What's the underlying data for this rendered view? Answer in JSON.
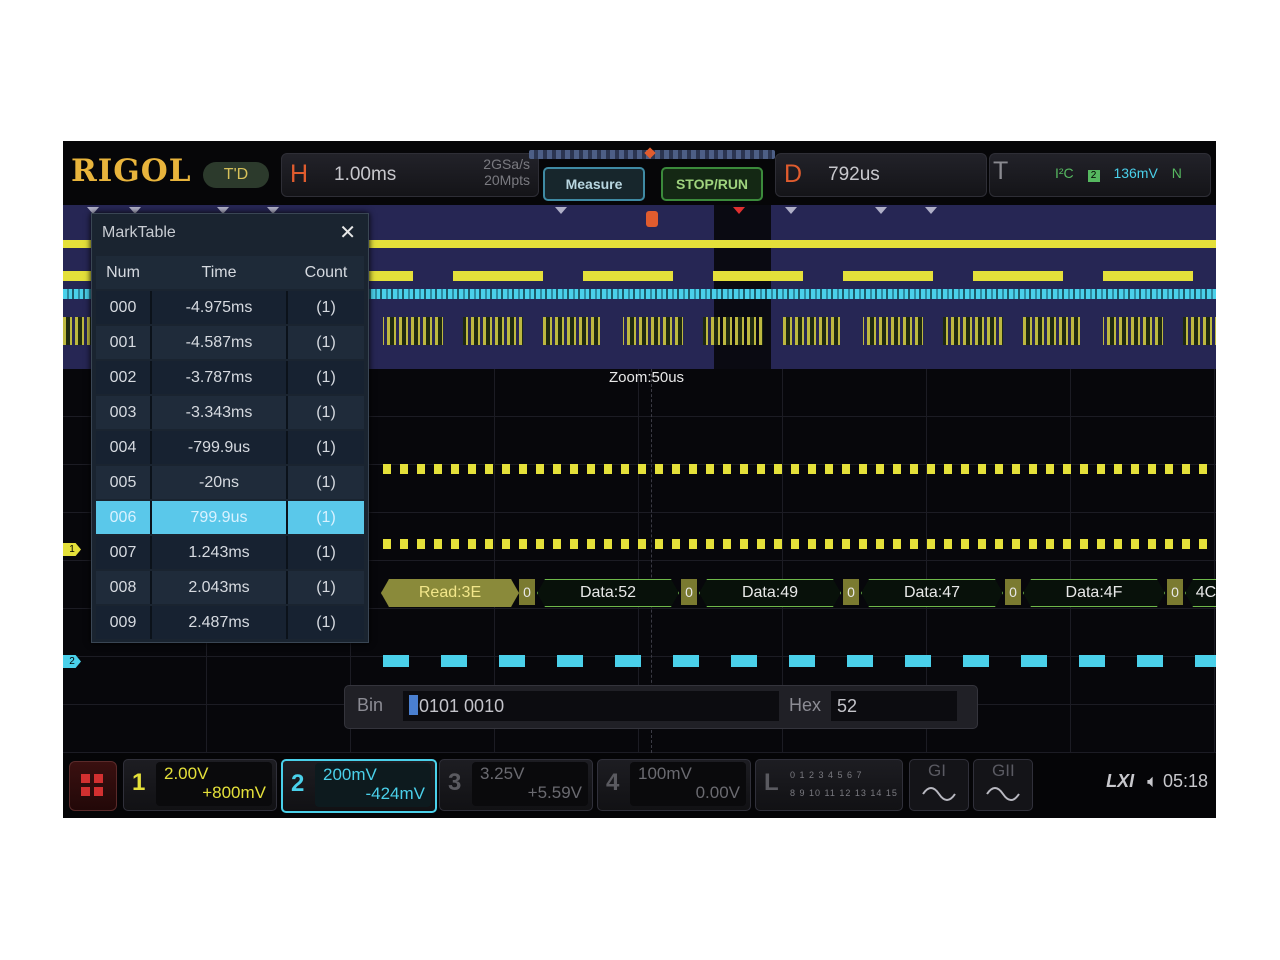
{
  "topbar": {
    "logo": "RIGOL",
    "mode_badge": "T'D",
    "horizontal": {
      "key": "H",
      "timebase": "1.00ms",
      "sample_rate": "2GSa/s",
      "memory_depth": "20Mpts"
    },
    "measure_label": "Measure",
    "stoprun_label": "STOP/RUN",
    "delay": {
      "key": "D",
      "value": "792us"
    },
    "trigger": {
      "key": "T",
      "type": "I²C",
      "channel": "2",
      "level": "136mV",
      "mode": "N"
    }
  },
  "zoom_label": "Zoom:50us",
  "marktable": {
    "title": "MarkTable",
    "close_icon": "close-icon",
    "columns": [
      "Num",
      "Time",
      "Count"
    ],
    "rows": [
      {
        "num": "000",
        "time": "-4.975ms",
        "count": "(1)"
      },
      {
        "num": "001",
        "time": "-4.587ms",
        "count": "(1)"
      },
      {
        "num": "002",
        "time": "-3.787ms",
        "count": "(1)"
      },
      {
        "num": "003",
        "time": "-3.343ms",
        "count": "(1)"
      },
      {
        "num": "004",
        "time": "-799.9us",
        "count": "(1)"
      },
      {
        "num": "005",
        "time": "-20ns",
        "count": "(1)"
      },
      {
        "num": "006",
        "time": "799.9us",
        "count": "(1)"
      },
      {
        "num": "007",
        "time": "1.243ms",
        "count": "(1)"
      },
      {
        "num": "008",
        "time": "2.043ms",
        "count": "(1)"
      },
      {
        "num": "009",
        "time": "2.487ms",
        "count": "(1)"
      }
    ],
    "selected_index": 6
  },
  "decode": {
    "packets": [
      "Read:3E",
      "Data:52",
      "Data:49",
      "Data:47",
      "Data:4F",
      "4C"
    ],
    "ack": "0"
  },
  "channel_markers": {
    "ch1": "1",
    "ch2": "2"
  },
  "binhex": {
    "bin_label": "Bin",
    "bin_value": "0101 0010",
    "hex_label": "Hex",
    "hex_value": "52"
  },
  "channels": [
    {
      "num": "1",
      "scale": "2.00V",
      "offset": "+800mV",
      "color": "#e4e03a"
    },
    {
      "num": "2",
      "scale": "200mV",
      "offset": "-424mV",
      "color": "#4ad0ea"
    },
    {
      "num": "3",
      "scale": "3.25V",
      "offset": "+5.59V",
      "color": "#6a6a70"
    },
    {
      "num": "4",
      "scale": "100mV",
      "offset": "0.00V",
      "color": "#6a6a70"
    }
  ],
  "la": {
    "key": "L",
    "bits_top": "0 1 2 3  4 5 6 7",
    "bits_bottom": "8 9 10 11  12 13 14 15"
  },
  "generators": [
    "GI",
    "GII"
  ],
  "status": {
    "lxi": "LXI",
    "speaker_icon": "speaker-muted-icon",
    "time": "05:18"
  },
  "colors": {
    "ch1": "#e4e03a",
    "ch2": "#4ad0ea",
    "decode": "#6fb84a",
    "brand": "#e8b43c"
  }
}
